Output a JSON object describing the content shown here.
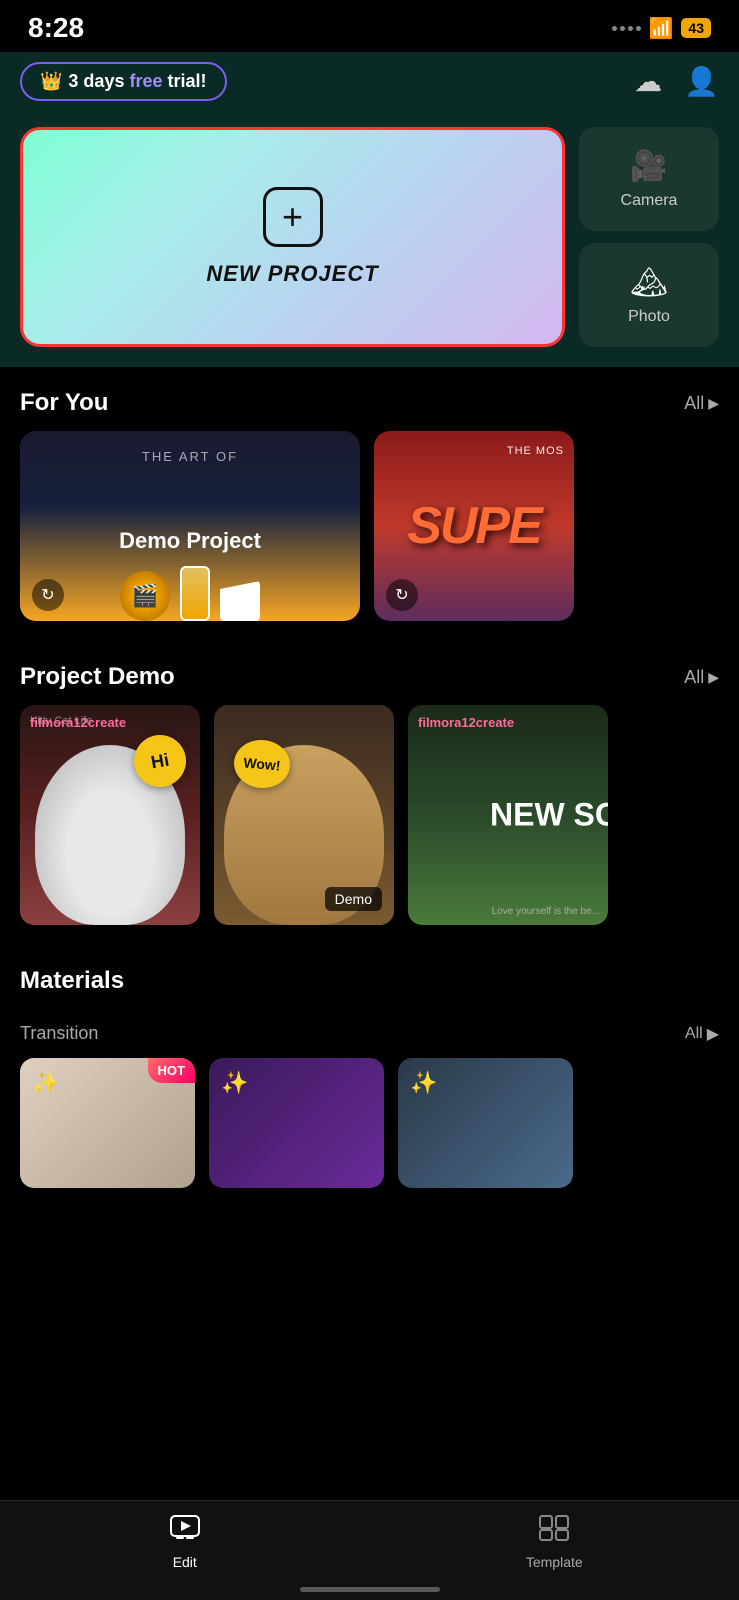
{
  "statusBar": {
    "time": "8:28",
    "battery": "43"
  },
  "header": {
    "trialLabel": "3 days free trial!",
    "trialFreeWord": "free",
    "cloudIcon": "cloud-icon",
    "userIcon": "user-icon"
  },
  "newProject": {
    "label": "NEW PROJECT"
  },
  "quickActions": [
    {
      "id": "camera",
      "label": "Camera",
      "icon": "📷"
    },
    {
      "id": "photo",
      "label": "Photo",
      "icon": "🌅"
    }
  ],
  "forYou": {
    "sectionTitle": "For You",
    "allLabel": "All",
    "cards": [
      {
        "subtitleTop": "THE ART OF",
        "title": "Demo Project"
      },
      {
        "labelTop": "THE MOS",
        "bigText": "SUPE"
      }
    ]
  },
  "projectDemo": {
    "sectionTitle": "Project Demo",
    "allLabel": "All",
    "cards": [
      {
        "watermark": "filmora12create",
        "kittyLabel": "Kitty Cat Life",
        "bubbleText": "Hi"
      },
      {
        "bubbleText": "Wow!",
        "badgeText": "Demo"
      },
      {
        "watermark": "filmora12create",
        "bigText": "NEW SC",
        "loveLabel": "Love yourself is the be..."
      }
    ]
  },
  "materials": {
    "sectionTitle": "Materials",
    "transitionLabel": "Transition",
    "allLabel": "All",
    "cards": [
      {
        "hotBadge": "HOT"
      },
      {},
      {}
    ]
  },
  "bottomNav": {
    "items": [
      {
        "id": "edit",
        "label": "Edit",
        "active": true
      },
      {
        "id": "template",
        "label": "Template",
        "active": false
      }
    ]
  }
}
